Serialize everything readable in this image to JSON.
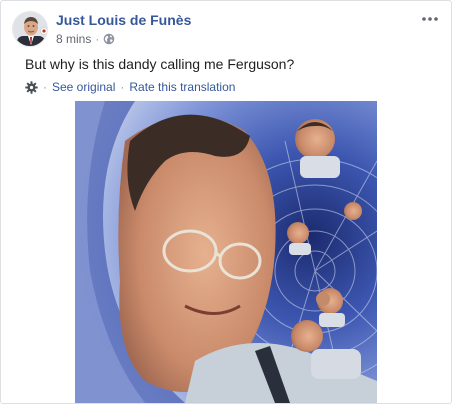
{
  "post": {
    "author": "Just Louis de Funès",
    "timestamp": "8 mins",
    "meta_separator": "·",
    "audience_icon": "globe-icon",
    "more_icon": "more-options-icon",
    "text": "But why is this dandy calling me Ferguson?",
    "translation": {
      "icon": "gear-icon",
      "separator": "·",
      "see_original": "See original",
      "rate": "Rate this translation"
    },
    "image_icon": "meme-image"
  },
  "colors": {
    "link": "#365899",
    "secondary_text": "#616770",
    "border": "#dddfe2"
  }
}
